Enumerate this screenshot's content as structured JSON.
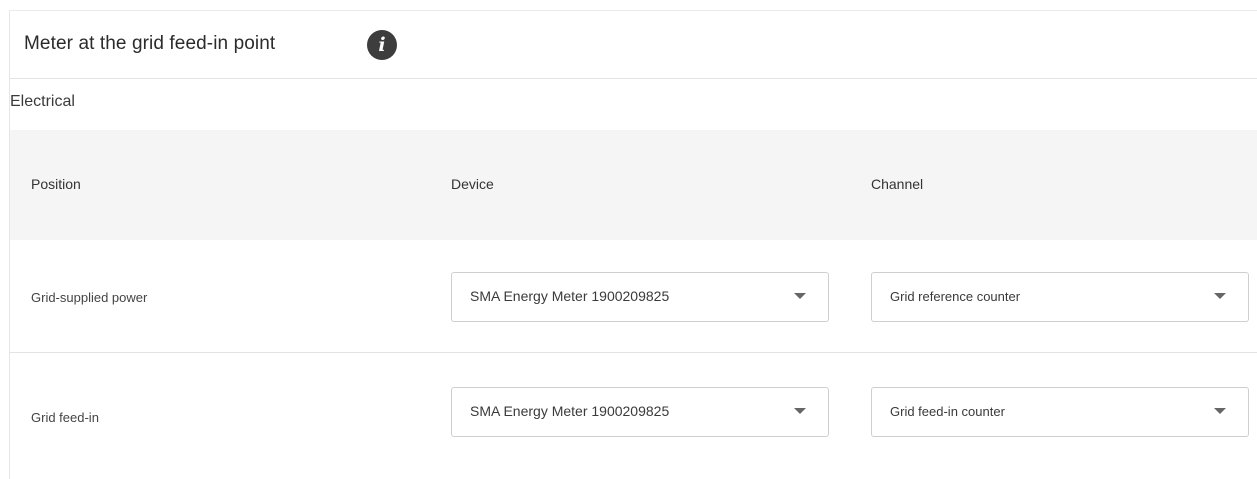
{
  "header": {
    "title": "Meter at the grid feed-in point",
    "info_icon_glyph": "i"
  },
  "section": {
    "label": "Electrical"
  },
  "table": {
    "columns": [
      "Position",
      "Device",
      "Channel"
    ],
    "rows": [
      {
        "position": "Grid-supplied power",
        "device": "SMA Energy Meter 1900209825",
        "channel": "Grid reference counter"
      },
      {
        "position": "Grid feed-in",
        "device": "SMA Energy Meter 1900209825",
        "channel": "Grid feed-in counter"
      }
    ]
  },
  "icons": {
    "info": "info-icon",
    "dropdown": "caret-down-icon"
  },
  "colors": {
    "header_bg": "#f5f5f5",
    "info_icon_bg": "#3d3d3d",
    "border": "#cfcfcf"
  }
}
